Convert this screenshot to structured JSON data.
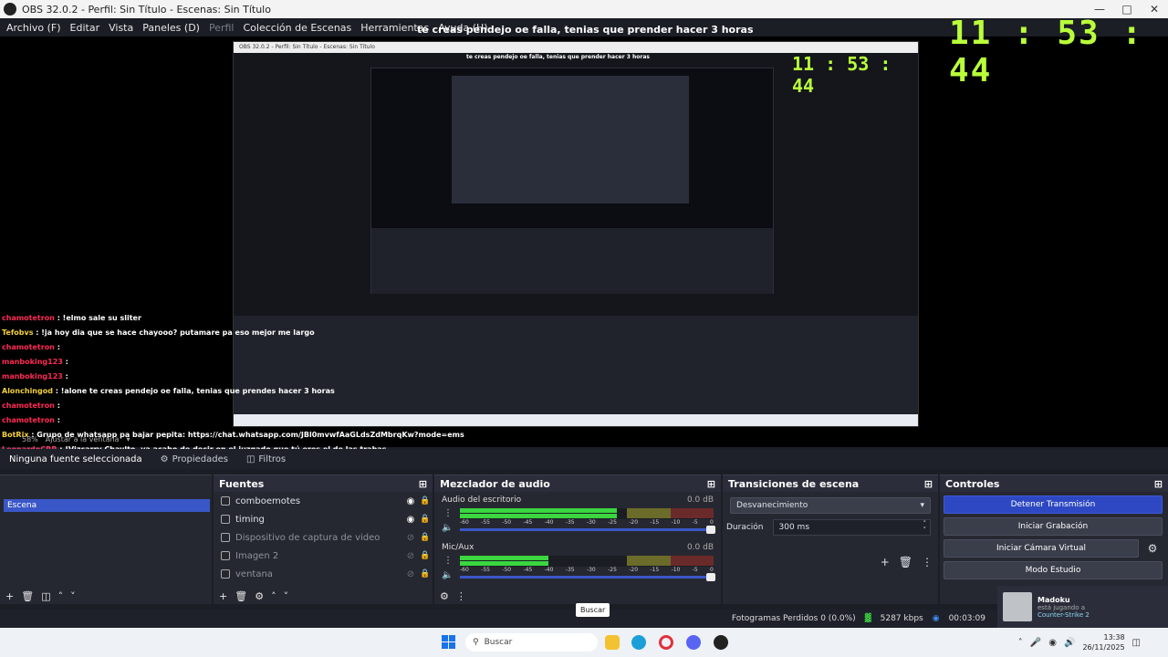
{
  "window": {
    "title": "OBS 32.0.2 - Perfil: Sin Título - Escenas: Sin Título"
  },
  "menu": [
    {
      "label": "Archivo (F)",
      "disabled": false
    },
    {
      "label": "Editar",
      "disabled": false
    },
    {
      "label": "Vista",
      "disabled": false
    },
    {
      "label": "Paneles (D)",
      "disabled": false
    },
    {
      "label": "Perfil",
      "disabled": true
    },
    {
      "label": "Colección de Escenas",
      "disabled": false
    },
    {
      "label": "Herramientas",
      "disabled": false
    },
    {
      "label": "Ayuda (H)",
      "disabled": false
    }
  ],
  "preview": {
    "overlay_message": "te creas pendejo oe falla, tenias que prender hacer 3 horas",
    "clock": "11 : 53 : 44",
    "chat": [
      {
        "user": "chamotetron",
        "msg": ": !elmo sale su sliter",
        "color": "r"
      },
      {
        "user": "Tefobvs",
        "msg": ": !ja hoy dia que se hace chayooo? putamare pa eso mejor me largo",
        "color": "y"
      },
      {
        "user": "chamotetron",
        "msg": ":",
        "color": "r"
      },
      {
        "user": "manboking123",
        "msg": ":",
        "color": "r"
      },
      {
        "user": "manboking123",
        "msg": ":",
        "color": "r"
      },
      {
        "user": "Alonchingod",
        "msg": ": !alone te creas pendejo oe falla, tenias que prendes hacer 3 horas",
        "color": "y"
      },
      {
        "user": "chamotetron",
        "msg": ":",
        "color": "r"
      },
      {
        "user": "chamotetron",
        "msg": ":",
        "color": "r"
      },
      {
        "user": "BotRix",
        "msg": ": Grupo de whatsapp pa bajar pepita: https://chat.whatsapp.com/JBl0mvwfAaGLdsZdMbrqKw?mode=ems",
        "color": "y"
      },
      {
        "user": "LeonardoCRR",
        "msg": ": !Vizcarry Chaylto, ya acabo de decir en el juzgado que tú eres el de las trabas",
        "color": "b"
      }
    ],
    "zoom": "58%",
    "zoom_label": "Ajustar a la ventana"
  },
  "tabs": [
    {
      "label": "Ninguna fuente seleccionada",
      "active": true
    },
    {
      "label": "Propiedades",
      "active": false
    },
    {
      "label": "Filtros",
      "active": false
    }
  ],
  "scenes": {
    "title": "Escenas",
    "items": [
      "Escena"
    ]
  },
  "sources": {
    "title": "Fuentes",
    "items": [
      {
        "name": "comboemotes",
        "visible": true,
        "dim": false
      },
      {
        "name": "timing",
        "visible": true,
        "dim": false
      },
      {
        "name": "Dispositivo de captura de video",
        "visible": false,
        "dim": true
      },
      {
        "name": "Imagen 2",
        "visible": false,
        "dim": true
      },
      {
        "name": "ventana",
        "visible": false,
        "dim": true
      }
    ]
  },
  "mixer": {
    "title": "Mezclador de audio",
    "channels": [
      {
        "name": "Audio del escritorio",
        "db": "0.0 dB",
        "level": 0.62
      },
      {
        "name": "Mic/Aux",
        "db": "0.0 dB",
        "level": 0.35
      }
    ],
    "scale": [
      "-60",
      "-55",
      "-50",
      "-45",
      "-40",
      "-35",
      "-30",
      "-25",
      "-20",
      "-15",
      "-10",
      "-5",
      "0"
    ]
  },
  "transitions": {
    "title": "Transiciones de escena",
    "selected": "Desvanecimiento",
    "duration_label": "Duración",
    "duration_value": "300 ms"
  },
  "controls": {
    "title": "Controles",
    "buttons": [
      "Detener Transmisión",
      "Iniciar Grabación",
      "Iniciar Cámara Virtual",
      "Modo Estudio"
    ]
  },
  "status": {
    "dropped": "Fotogramas Perdidos 0 (0.0%)",
    "kbps": "5287 kbps",
    "time": "00:03:09"
  },
  "notification": {
    "name": "Madoku",
    "line2": "está jugando a",
    "game": "Counter-Strike 2"
  },
  "tooltip": "Buscar",
  "taskbar": {
    "search_placeholder": "Buscar",
    "time": "13:38",
    "date": "26/11/2025"
  },
  "colors": {
    "accent": "#2d48c2",
    "clock": "#b9ff3a",
    "meter_green": "#3bd640"
  }
}
